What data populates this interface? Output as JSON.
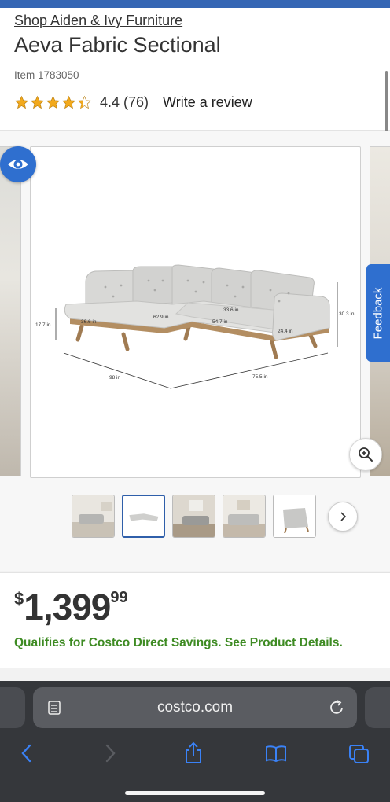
{
  "header": {
    "brand_link": "Shop Aiden & Ivy Furniture",
    "title": "Aeva Fabric Sectional",
    "item_number": "Item 1783050",
    "rating": 4.4,
    "rating_text": "4.4 (76)",
    "write_review": "Write a review"
  },
  "gallery": {
    "feedback_label": "Feedback",
    "dimension_labels": {
      "left_depth": "98 in",
      "right_width": "75.5 in",
      "height": "30.3 in",
      "seat_height": "17.7 in",
      "chaise_depth": "36.6 in",
      "seat_depth_1": "62.9 in",
      "seat_depth_2": "54.7 in",
      "arm": "24.4 in",
      "back": "33.6 in"
    },
    "thumbnail_count": 5,
    "active_thumbnail": 2
  },
  "price": {
    "currency": "$",
    "dollars": "1,399",
    "cents": "99",
    "savings_text": "Qualifies for Costco Direct Savings. See Product Details."
  },
  "browser": {
    "url": "costco.com"
  },
  "icons": {
    "view": "eye-icon",
    "zoom": "zoom-in-icon",
    "next": "chevron-right-icon",
    "reader": "reader-icon",
    "reload": "reload-icon",
    "back": "back-arrow-icon",
    "forward": "forward-arrow-icon",
    "share": "share-icon",
    "bookmarks": "book-icon",
    "tabs": "tabs-icon"
  },
  "colors": {
    "brand_blue": "#2f6fcf",
    "top_bar": "#3566b4",
    "savings_green": "#3e8b23",
    "star_gold": "#f2a91c"
  }
}
